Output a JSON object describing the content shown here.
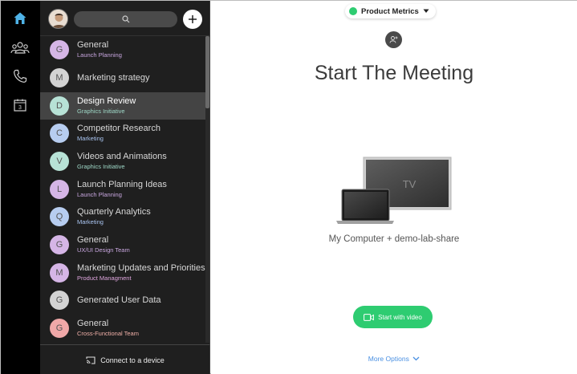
{
  "colors": {
    "rail_bg": "#000000",
    "panel_bg": "#1f1f1f",
    "selected_bg": "#444444",
    "accent_green": "#2ecc71",
    "home_icon": "#4fb3e8",
    "link_blue": "#4a90e2"
  },
  "rail": {
    "icons": [
      "home-icon",
      "contacts-icon",
      "phone-icon",
      "calendar-icon"
    ],
    "calendar_day": "3"
  },
  "panel": {
    "search_icon": "search-icon",
    "add_icon": "plus-icon",
    "conversations": [
      {
        "initial": "G",
        "name": "General",
        "sub": "Launch Planning",
        "avatar_color": "#d5b5e6",
        "sub_color": "#c9a7e0"
      },
      {
        "initial": "M",
        "name": "Marketing strategy",
        "sub": "",
        "avatar_color": "#d3d3d3",
        "sub_color": "#d3d3d3"
      },
      {
        "initial": "D",
        "name": "Design Review",
        "sub": "Graphics Initiative",
        "avatar_color": "#b7e2d6",
        "sub_color": "#9fd9c8",
        "selected": true
      },
      {
        "initial": "C",
        "name": "Competitor Research",
        "sub": "Marketing",
        "avatar_color": "#b7cdf0",
        "sub_color": "#a9c4f0"
      },
      {
        "initial": "V",
        "name": "Videos and Animations",
        "sub": "Graphics Initiative",
        "avatar_color": "#b7e2d6",
        "sub_color": "#9fd9c8"
      },
      {
        "initial": "L",
        "name": "Launch Planning Ideas",
        "sub": "Launch Planning",
        "avatar_color": "#d5b5e6",
        "sub_color": "#c9a7e0"
      },
      {
        "initial": "Q",
        "name": "Quarterly Analytics",
        "sub": "Marketing",
        "avatar_color": "#b7cdf0",
        "sub_color": "#a9c4f0"
      },
      {
        "initial": "G",
        "name": "General",
        "sub": "UX/UI Design Team",
        "avatar_color": "#d5b5e6",
        "sub_color": "#c9a7e0"
      },
      {
        "initial": "M",
        "name": "Marketing Updates and Priorities",
        "sub": "Product Managment",
        "avatar_color": "#d5b5e6",
        "sub_color": "#e0a7df"
      },
      {
        "initial": "G",
        "name": "Generated User Data",
        "sub": "",
        "avatar_color": "#d3d3d3",
        "sub_color": "#d3d3d3"
      },
      {
        "initial": "G",
        "name": "General",
        "sub": "Cross-Functional Team",
        "avatar_color": "#f0a8a8",
        "sub_color": "#f0b0a8"
      }
    ],
    "connect_label": "Connect to a device"
  },
  "main": {
    "room_name": "Product Metrics",
    "title": "Start The Meeting",
    "tv_label": "TV",
    "device_label": "My Computer + demo-lab-share",
    "start_label": "Start with video",
    "more_label": "More Options"
  }
}
